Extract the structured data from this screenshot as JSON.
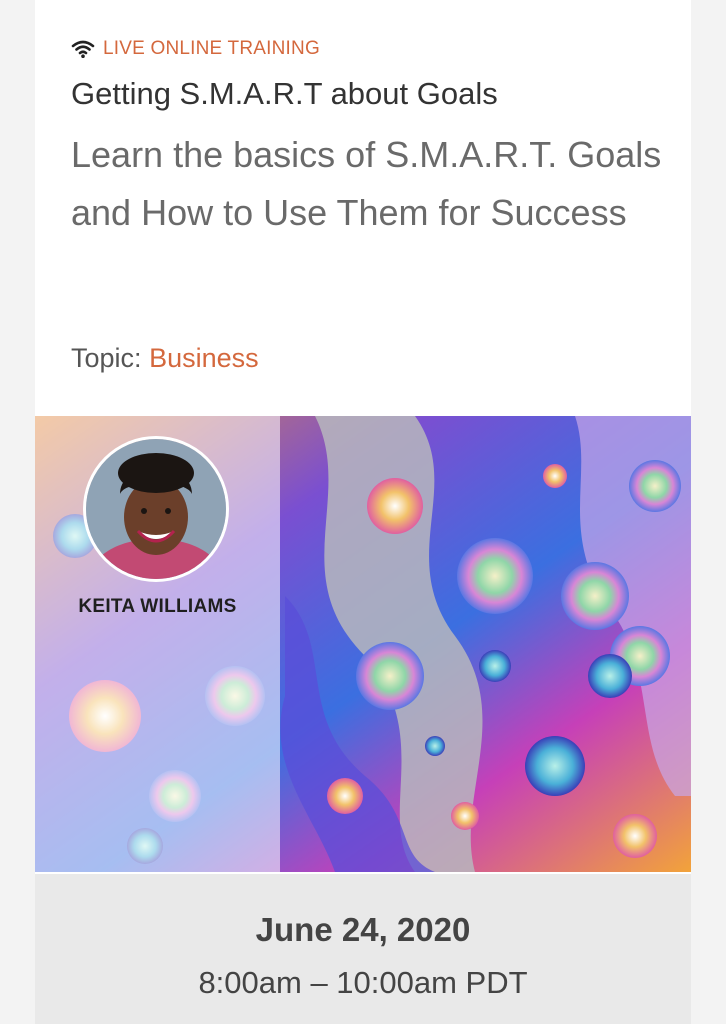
{
  "event": {
    "format_icon": "wifi-icon",
    "format_label": "LIVE ONLINE TRAINING",
    "title": "Getting S.M.A.R.T about Goals",
    "subtitle": "Learn the basics of S.M.A.R.T. Goals and How to Use Them for Success",
    "topic_label": "Topic:",
    "topic_value": "Business",
    "presenter_name": "KEITA WILLIAMS",
    "date": "June 24, 2020",
    "time": "8:00am – 10:00am PDT"
  },
  "colors": {
    "accent": "#d4683d",
    "title_text": "#333333",
    "subtitle_text": "#6a6a6a",
    "date_panel_bg": "#e9e9e9"
  }
}
